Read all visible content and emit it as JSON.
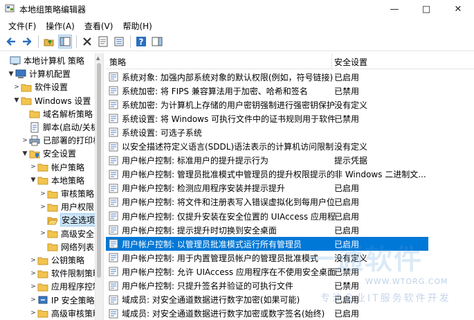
{
  "window": {
    "title": "本地组策略编辑器",
    "min_icon": "minimize-icon",
    "max_icon": "maximize-icon",
    "close_icon": "close-icon"
  },
  "menu": [
    "文件(F)",
    "操作(A)",
    "查看(V)",
    "帮助(H)"
  ],
  "toolbar": [
    "back-arrow-icon",
    "forward-arrow-icon",
    "up-folder-icon",
    "show-hide-tree-icon",
    "delete-icon",
    "properties-icon",
    "export-list-icon",
    "help-icon",
    "show-pane-icon"
  ],
  "tree": [
    {
      "label": "本地计算机 策略",
      "icon": "computer-policy-icon",
      "exp": ""
    },
    {
      "label": "计算机配置",
      "icon": "computer-icon",
      "exp": "▼"
    },
    {
      "label": "软件设置",
      "icon": "folder-icon",
      "exp": ">"
    },
    {
      "label": "Windows 设置",
      "icon": "folder-icon",
      "exp": "▼"
    },
    {
      "label": "域名解析策略",
      "icon": "folder-icon",
      "exp": ""
    },
    {
      "label": "脚本(启动/关机)",
      "icon": "script-icon",
      "exp": ""
    },
    {
      "label": "已部署的打印机",
      "icon": "printer-icon",
      "exp": ">"
    },
    {
      "label": "安全设置",
      "icon": "security-icon",
      "exp": "▼"
    },
    {
      "label": "帐户策略",
      "icon": "folder-icon",
      "exp": ">"
    },
    {
      "label": "本地策略",
      "icon": "folder-icon",
      "exp": "▼"
    },
    {
      "label": "审核策略",
      "icon": "folder-icon",
      "exp": ">"
    },
    {
      "label": "用户权限",
      "icon": "folder-icon",
      "exp": ">"
    },
    {
      "label": "安全选项",
      "icon": "folder-open-icon",
      "exp": ""
    },
    {
      "label": "高级安全 W",
      "icon": "folder-icon",
      "exp": ">"
    },
    {
      "label": "网络列表管理",
      "icon": "folder-icon",
      "exp": ""
    },
    {
      "label": "公钥策略",
      "icon": "folder-icon",
      "exp": ">"
    },
    {
      "label": "软件限制策略",
      "icon": "folder-icon",
      "exp": ">"
    },
    {
      "label": "应用程序控制",
      "icon": "folder-icon",
      "exp": ">"
    },
    {
      "label": "IP 安全策略",
      "icon": "ip-security-icon",
      "exp": ">"
    },
    {
      "label": "高级审核策略",
      "icon": "folder-icon",
      "exp": ">"
    }
  ],
  "columns": {
    "policy": "策略",
    "setting": "安全设置"
  },
  "rows": [
    {
      "policy": "系统对象: 加强内部系统对象的默认权限(例如，符号链接)",
      "setting": "已启用"
    },
    {
      "policy": "系统加密: 将 FIPS 兼容算法用于加密、哈希和签名",
      "setting": "已禁用"
    },
    {
      "policy": "系统加密: 为计算机上存储的用户密钥强制进行强密钥保护",
      "setting": "没有定义"
    },
    {
      "policy": "系统设置: 将 Windows 可执行文件中的证书规则用于软件...",
      "setting": "已禁用"
    },
    {
      "policy": "系统设置: 可选子系统",
      "setting": ""
    },
    {
      "policy": "以安全描述符定义语言(SDDL)语法表示的计算机访问限制",
      "setting": "没有定义"
    },
    {
      "policy": "用户帐户控制: 标准用户的提升提示行为",
      "setting": "提示凭据"
    },
    {
      "policy": "用户帐户控制: 管理员批准模式中管理员的提升权限提示的...",
      "setting": "非 Windows 二进制文..."
    },
    {
      "policy": "用户帐户控制: 检测应用程序安装并提示提升",
      "setting": "已启用"
    },
    {
      "policy": "用户帐户控制: 将文件和注册表写入错误虚拟化到每用户位置",
      "setting": "已启用"
    },
    {
      "policy": "用户帐户控制: 仅提升安装在安全位置的 UIAccess 应用程序",
      "setting": "已启用"
    },
    {
      "policy": "用户帐户控制: 提示提升时切换到安全桌面",
      "setting": "已启用"
    },
    {
      "policy": "用户帐户控制: 以管理员批准模式运行所有管理员",
      "setting": "已启用",
      "selected": true
    },
    {
      "policy": "用户帐户控制: 用于内置管理员帐户的管理员批准模式",
      "setting": "没有定义"
    },
    {
      "policy": "用户帐户控制: 允许 UIAccess 应用程序在不使用安全桌面...",
      "setting": "已禁用"
    },
    {
      "policy": "用户帐户控制: 只提升签名并验证的可执行文件",
      "setting": "已禁用"
    },
    {
      "policy": "域成员: 对安全通道数据进行数字加密(如果可能)",
      "setting": "已启用"
    },
    {
      "policy": "域成员: 对安全通道数据进行数字加密或数字签名(始终)",
      "setting": "已启用"
    }
  ],
  "watermark": {
    "big": "一通软件",
    "url": "WWW.WTORG.COM",
    "small": "专注企业IT服务软件开发"
  }
}
